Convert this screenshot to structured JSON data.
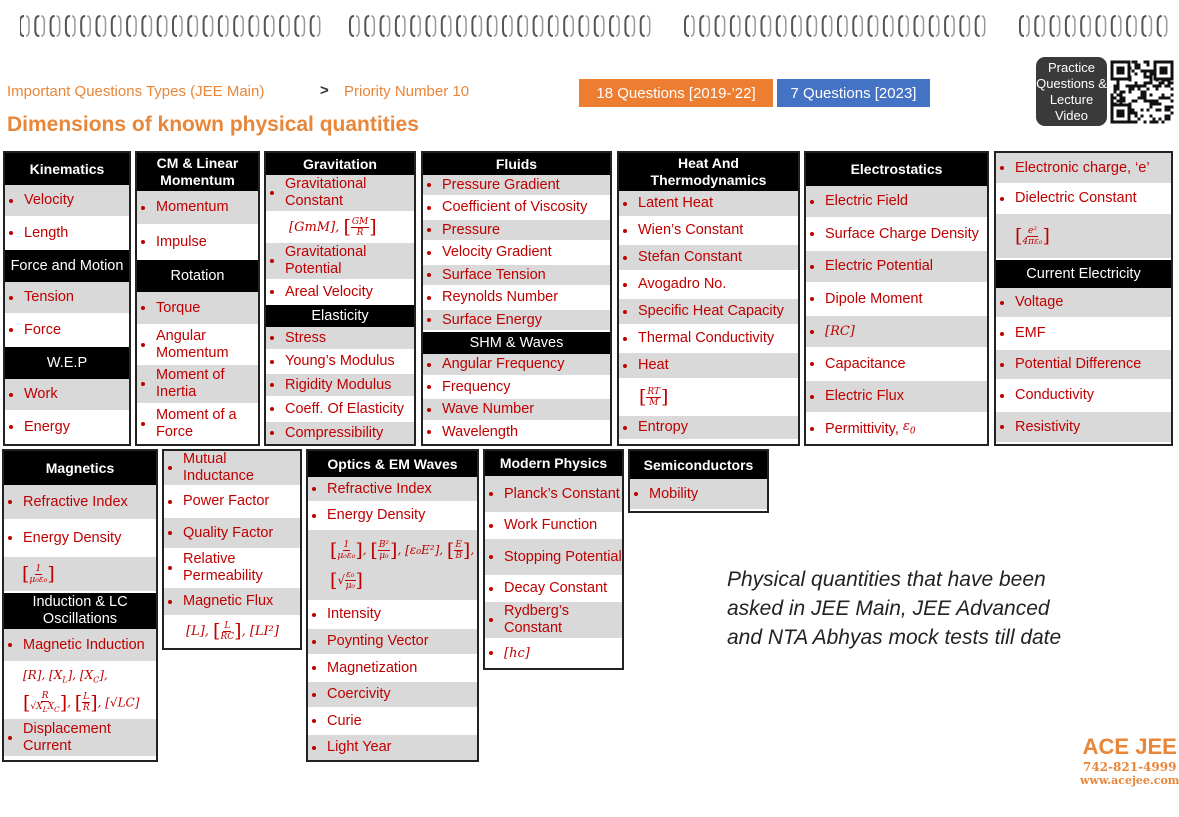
{
  "header": {
    "breadcrumb_left": "Important Questions Types (JEE Main)",
    "separator": ">",
    "breadcrumb_right": "Priority Number 10",
    "title": "Dimensions of known physical quantities",
    "badge1": "18 Questions [2019-’22]",
    "badge2": "7 Questions [2023]",
    "practice": "Practice Questions & Lecture Video"
  },
  "colors": {
    "accent": "#e8863a",
    "badge1": "#ed7d31",
    "badge2": "#4472c4",
    "item_text": "#c00000"
  },
  "kinematics": {
    "h": "Kinematics",
    "velocity": "Velocity",
    "length": "Length",
    "fam": "Force and Motion",
    "tension": "Tension",
    "force": "Force",
    "wep": "W.E.P",
    "work": "Work",
    "energy": "Energy"
  },
  "cm": {
    "h": "CM & Linear Momentum",
    "momentum": "Momentum",
    "impulse": "Impulse",
    "rotation": "Rotation",
    "torque": "Torque",
    "ang_mom": "Angular Momentum",
    "moi": "Moment of Inertia",
    "mof": "Moment of a Force"
  },
  "grav": {
    "h": "Gravitation",
    "gc": "Gravitational Constant",
    "gmm": "[GmM], ",
    "gp": "Gravitational Potential",
    "av": "Areal Velocity",
    "elasticity": "Elasticity",
    "stress": "Stress",
    "ym": "Young’s Modulus",
    "rm": "Rigidity Modulus",
    "ce": "Coeff. Of Elasticity",
    "comp": "Compressibility"
  },
  "fluids": {
    "h": "Fluids",
    "pg": "Pressure Gradient",
    "cv": "Coefficient of Viscosity",
    "pressure": "Pressure",
    "vg": "Velocity Gradient",
    "st": "Surface Tension",
    "rn": "Reynolds Number",
    "se": "Surface Energy",
    "shm": "SHM & Waves",
    "af": "Angular Frequency",
    "freq": "Frequency",
    "wn": "Wave Number",
    "wl": "Wavelength"
  },
  "heat": {
    "h": "Heat And Thermodynamics",
    "lh": "Latent Heat",
    "wc": "Wien’s Constant",
    "sc": "Stefan Constant",
    "av": "Avogadro No.",
    "shc": "Specific Heat Capacity",
    "tc": "Thermal Conductivity",
    "heat": "Heat",
    "entropy": "Entropy"
  },
  "electro": {
    "h": "Electrostatics",
    "ef": "Electric Field",
    "scd": "Surface Charge Density",
    "ep": "Electric Potential",
    "dm": "Dipole Moment",
    "rc": "[RC]",
    "cap": "Capacitance",
    "eflux": "Electric Flux",
    "perm": "Permittivity, "
  },
  "elec2": {
    "charge": "Electronic charge, ‘e’",
    "dc": "Dielectric Constant",
    "ce_h": "Current Electricity",
    "voltage": "Voltage",
    "emf": "EMF",
    "pd": "Potential Difference",
    "cond": "Conductivity",
    "res": "Resistivity"
  },
  "magnetics": {
    "h": "Magnetics",
    "ri": "Refractive Index",
    "ed": "Energy Density",
    "ilc": "Induction & LC Oscillations",
    "mi": "Magnetic Induction",
    "rx": "[R], [X",
    "dc": "Displacement Current"
  },
  "mutual": {
    "mi": "Mutual Inductance",
    "pf": "Power Factor",
    "qf": "Quality Factor",
    "rp": "Relative Permeability",
    "mf": "Magnetic Flux"
  },
  "optics": {
    "h": "Optics & EM Waves",
    "ri": "Refractive Index",
    "ed": "Energy Density",
    "intensity": "Intensity",
    "pv": "Poynting Vector",
    "mag": "Magnetization",
    "coer": "Coercivity",
    "curie": "Curie",
    "ly": "Light Year"
  },
  "modern": {
    "h": "Modern Physics",
    "pc": "Planck’s Constant",
    "wf": "Work Function",
    "sp": "Stopping Potential",
    "dc": "Decay Constant",
    "rc": "Rydberg’s Constant",
    "hc": "[hc]"
  },
  "semi": {
    "h": "Semiconductors",
    "mob": "Mobility"
  },
  "note": [
    "Physical quantities that have been",
    "asked in JEE Main, JEE Advanced",
    "and NTA Abhyas mock tests till date"
  ],
  "logo": {
    "name": "ACE JEE",
    "phone": "742-821-4999",
    "web": "www.acejee.com"
  }
}
